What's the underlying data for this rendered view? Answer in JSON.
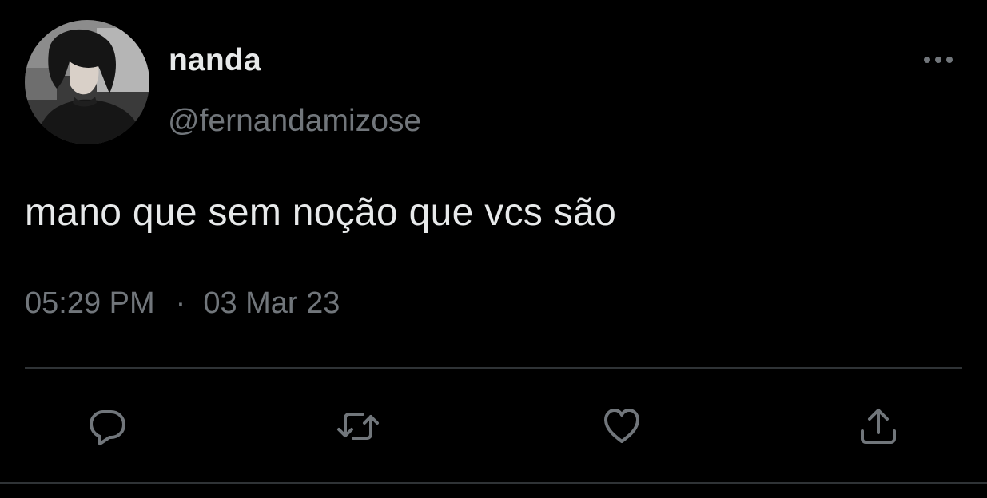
{
  "user": {
    "display_name": "nanda",
    "handle": "@fernandamizose",
    "avatar_icon": "profile-photo"
  },
  "tweet": {
    "text": "mano que sem noção que vcs são",
    "time": "05:29 PM",
    "separator": "·",
    "date": "03 Mar 23"
  },
  "actions": [
    {
      "name": "reply",
      "icon": "speech-bubble-icon"
    },
    {
      "name": "retweet",
      "icon": "retweet-arrows-icon"
    },
    {
      "name": "like",
      "icon": "heart-icon"
    },
    {
      "name": "share",
      "icon": "share-upload-icon"
    }
  ],
  "menu": {
    "icon": "ellipsis-icon"
  },
  "colors": {
    "background": "#000000",
    "primary_text": "#e7e9ea",
    "secondary_text": "#71767b",
    "divider": "#2f3336"
  }
}
